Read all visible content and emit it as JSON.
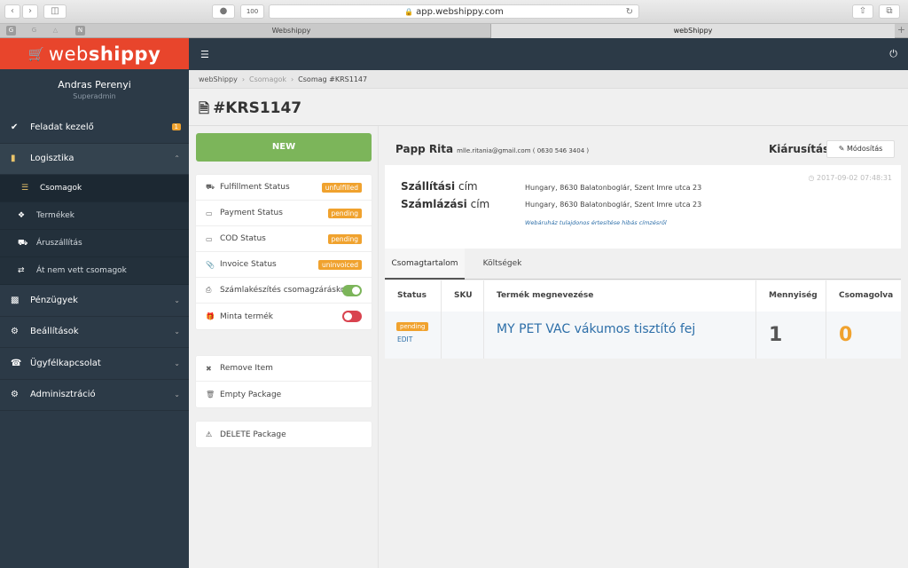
{
  "browser": {
    "url": "app.webshippy.com",
    "badge_count": "100",
    "tabs": [
      {
        "label": "Webshippy"
      },
      {
        "label": "webShippy"
      }
    ],
    "favorites": [
      "G",
      "G",
      "△",
      "N"
    ]
  },
  "sidebar": {
    "logo_light": "web",
    "logo_bold": "shippy",
    "user_name": "Andras Perenyi",
    "user_role": "Superadmin",
    "items": [
      {
        "label": "Feladat kezelő",
        "icon": "check-icon",
        "badge": "1"
      },
      {
        "label": "Logisztika",
        "icon": "book-icon",
        "expanded": true
      },
      {
        "label": "Pénzügyek",
        "icon": "bar-chart-icon"
      },
      {
        "label": "Beállítások",
        "icon": "gears-icon"
      },
      {
        "label": "Ügyfélkapcsolat",
        "icon": "phone-icon"
      },
      {
        "label": "Adminisztráció",
        "icon": "gears-icon"
      }
    ],
    "subitems": [
      {
        "label": "Csomagok",
        "icon": "list-icon",
        "active": true
      },
      {
        "label": "Termékek",
        "icon": "tags-icon"
      },
      {
        "label": "Áruszállítás",
        "icon": "truck-icon"
      },
      {
        "label": "Át nem vett csomagok",
        "icon": "retweet-icon"
      }
    ]
  },
  "breadcrumb": [
    "webShippy",
    "Csomagok",
    "Csomag #KRS1147"
  ],
  "page_title": "#KRS1147",
  "left": {
    "status_button": "NEW",
    "statuses": [
      {
        "label": "Fulfillment Status",
        "value": "unfulfilled",
        "icon": "truck-icon"
      },
      {
        "label": "Payment Status",
        "value": "pending",
        "icon": "credit-card-icon"
      },
      {
        "label": "COD Status",
        "value": "pending",
        "icon": "credit-card-icon"
      },
      {
        "label": "Invoice Status",
        "value": "uninvoiced",
        "icon": "paperclip-icon"
      }
    ],
    "toggles": [
      {
        "label": "Számlakészítés csomagzáráskor",
        "icon": "print-icon",
        "on": true
      },
      {
        "label": "Minta termék",
        "icon": "gift-icon",
        "on": false
      }
    ],
    "actions": [
      {
        "label": "Remove Item",
        "icon": "close-icon"
      },
      {
        "label": "Empty Package",
        "icon": "trash-icon"
      }
    ],
    "delete_label": "DELETE Package"
  },
  "customer": {
    "name": "Papp Rita",
    "email": "mlle.ritania@gmail.com",
    "phone": "( 0630 546 3404 )",
    "shop": "Kiárusítás",
    "edit_label": "Módosítás",
    "timestamp": "2017-09-02 07:48:31",
    "shipping_label_bold": "Szállítási",
    "shipping_label_rest": " cím",
    "shipping_address": "Hungary, 8630 Balatonboglár, Szent Imre utca 23",
    "billing_label_bold": "Számlázási",
    "billing_label_rest": " cím",
    "billing_address": "Hungary, 8630 Balatonboglár, Szent Imre utca 23",
    "notify_link": "Webáruház tulajdonos értesítése hibás címzésről"
  },
  "content_tabs": [
    {
      "label": "Csomagtartalom",
      "active": true
    },
    {
      "label": "Költségek"
    }
  ],
  "table": {
    "headers": [
      "Status",
      "SKU",
      "Termék megnevezése",
      "Mennyiség",
      "Csomagolva"
    ],
    "rows": [
      {
        "status": "pending",
        "edit": "EDIT",
        "sku": "",
        "name": "MY PET VAC vákumos tisztító fej",
        "qty": "1",
        "packed": "0"
      }
    ]
  },
  "colors": {
    "brand": "#e8452c",
    "sidebar": "#2c3a47",
    "success": "#7cb55a",
    "warning": "#f0a22e",
    "danger": "#d9434f",
    "link": "#2c6ea8"
  }
}
